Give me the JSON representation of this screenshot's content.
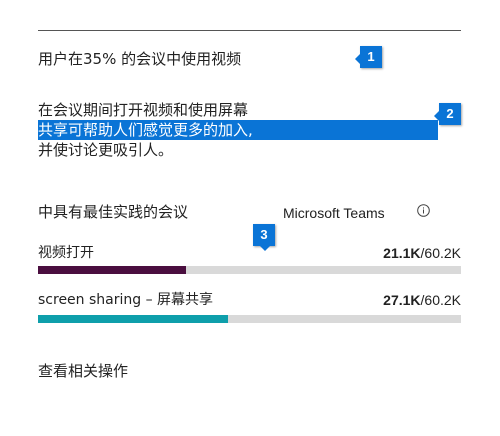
{
  "headline": "用户在35% 的会议中使用视频",
  "description": {
    "line1": "在会议期间打开视频和使用屏幕",
    "line2": "共享可帮助人们感觉更多的加入,",
    "line3": "并使讨论更吸引人。"
  },
  "section": {
    "title": "中具有最佳实践的会议",
    "product": "Microsoft Teams",
    "info_icon": "info-circle-icon"
  },
  "metrics": [
    {
      "label": "视频打开",
      "value": "21.1K",
      "total": "/60.2K",
      "fraction": 0.35,
      "color": "#4a0e3f"
    },
    {
      "label": "screen sharing – 屏幕共享",
      "value": "27.1K",
      "total": "/60.2K",
      "fraction": 0.45,
      "color": "#0e9fab"
    }
  ],
  "link": "查看相关操作",
  "callouts": [
    "1",
    "2",
    "3"
  ],
  "colors": {
    "highlight": "#0a74d6",
    "track": "#d9d9d9"
  }
}
